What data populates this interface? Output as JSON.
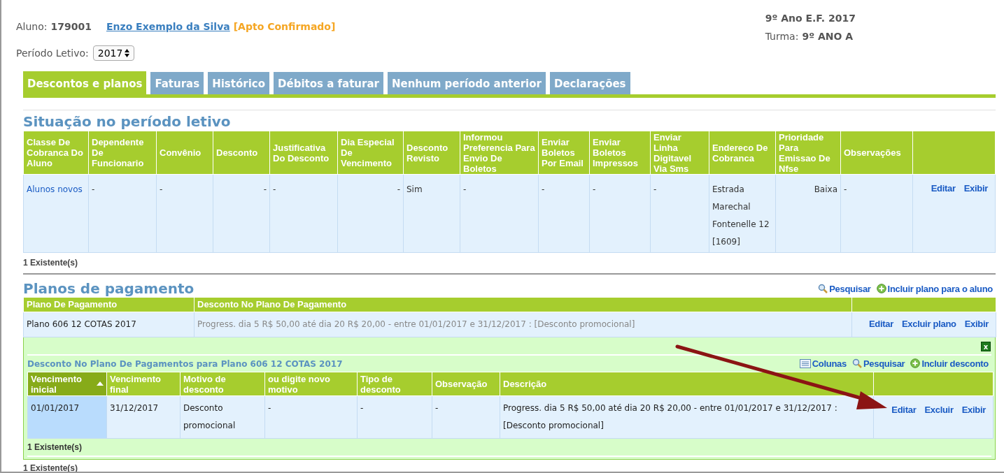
{
  "student": {
    "label": "Aluno:",
    "id": "179001",
    "name": "Enzo Exemplo da Silva",
    "status": "[Apto Confirmado]"
  },
  "grade": {
    "course": "9º Ano E.F. 2017",
    "class_label": "Turma:",
    "class": "9º ANO A"
  },
  "period": {
    "label": "Período Letivo:",
    "value": "2017"
  },
  "tabs": [
    {
      "label": "Descontos e planos",
      "selected": true
    },
    {
      "label": "Faturas",
      "selected": false
    },
    {
      "label": "Histórico",
      "selected": false
    },
    {
      "label": "Débitos a faturar",
      "selected": false
    },
    {
      "label": "Nenhum período anterior",
      "selected": false
    },
    {
      "label": "Declarações",
      "selected": false
    }
  ],
  "situation": {
    "title": "Situação no período letivo",
    "columns": [
      "Classe De Cobranca Do Aluno",
      "Dependente De Funcionario",
      "Convênio",
      "Desconto",
      "Justificativa Do Desconto",
      "Dia Especial De Vencimento",
      "Desconto Revisto",
      "Informou Preferencia Para Envio De Boletos",
      "Enviar Boletos Por Email",
      "Enviar Boletos Impressos",
      "Enviar Linha Digitavel Via Sms",
      "Endereco De Cobranca",
      "Prioridade Para Emissao De Nfse",
      "Observações"
    ],
    "rows": [
      {
        "cells": [
          "Alunos novos",
          "-",
          "-",
          "-",
          "-",
          "-",
          "Sim",
          "-",
          "-",
          "-",
          "-",
          "Estrada Marechal Fontenelle 12 [1609]",
          "Baixa",
          "-"
        ],
        "actions": [
          "Editar",
          "Exibir"
        ]
      }
    ],
    "count": "1 Existente(s)"
  },
  "plans": {
    "title": "Planos de pagamento",
    "toolbar": [
      {
        "kind": "search",
        "label": "Pesquisar"
      },
      {
        "kind": "add",
        "label": "Incluir plano para o aluno"
      }
    ],
    "columns": [
      "Plano De Pagamento",
      "Desconto No Plano De Pagamento"
    ],
    "rows": [
      {
        "cells": [
          "Plano 606 12 COTAS 2017",
          "Progress. dia 5 R$ 50,00 até dia 20 R$ 20,00 - entre 01/01/2017 e 31/12/2017 : [Desconto promocional]"
        ],
        "actions": [
          "Editar",
          "Excluir plano",
          "Exibir"
        ]
      }
    ],
    "detail": {
      "close": "x",
      "title": "Desconto No Plano De Pagamentos para Plano 606 12 COTAS 2017",
      "toolbar": [
        {
          "kind": "columns",
          "label": "Colunas"
        },
        {
          "kind": "search",
          "label": "Pesquisar"
        },
        {
          "kind": "add",
          "label": "Incluir desconto"
        }
      ],
      "columns": [
        {
          "label": "Vencimento inicial",
          "sorted": true
        },
        {
          "label": "Vencimento final",
          "sorted": false
        },
        {
          "label": "Motivo de desconto",
          "sorted": false
        },
        {
          "label": "ou digite novo motivo",
          "sorted": false
        },
        {
          "label": "Tipo de desconto",
          "sorted": false
        },
        {
          "label": "Observação",
          "sorted": false
        },
        {
          "label": "Descrição",
          "sorted": false
        }
      ],
      "rows": [
        {
          "cells": [
            "01/01/2017",
            "31/12/2017",
            "Desconto promocional",
            "-",
            "-",
            "-",
            "Progress. dia 5 R$ 50,00 até dia 20 R$ 20,00 - entre 01/01/2017 e 31/12/2017 : [Desconto promocional]"
          ],
          "actions": [
            "Editar",
            "Excluir",
            "Exibir"
          ]
        }
      ],
      "count": "1 Existente(s)"
    },
    "count": "1 Existente(s)"
  }
}
